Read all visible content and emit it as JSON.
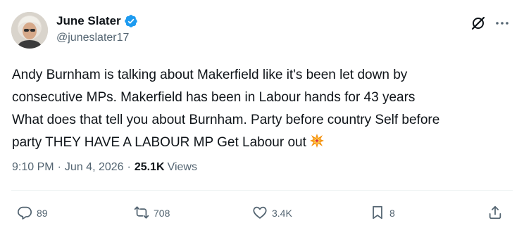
{
  "author": {
    "display_name": "June Slater",
    "handle": "@juneslater17",
    "verified": true
  },
  "tweet": {
    "text": "Andy Burnham is talking about Makerfield like it's been let down by\nconsecutive MPs. Makerfield has been in Labour hands for 43 years\nWhat does that tell you about Burnham. Party before country  Self before\nparty THEY HAVE A LABOUR MP  Get Labour out",
    "emoji": "collision-icon"
  },
  "meta": {
    "time": "9:10 PM",
    "separator": "·",
    "date": "Jun 4, 2026",
    "views_count": "25.1K",
    "views_label": "Views"
  },
  "actions": {
    "replies": "89",
    "reposts": "708",
    "likes": "3.4K",
    "bookmarks": "8"
  },
  "colors": {
    "text": "#0f1419",
    "secondary": "#536471",
    "verified": "#1d9bf0",
    "divider": "#eff3f4"
  }
}
